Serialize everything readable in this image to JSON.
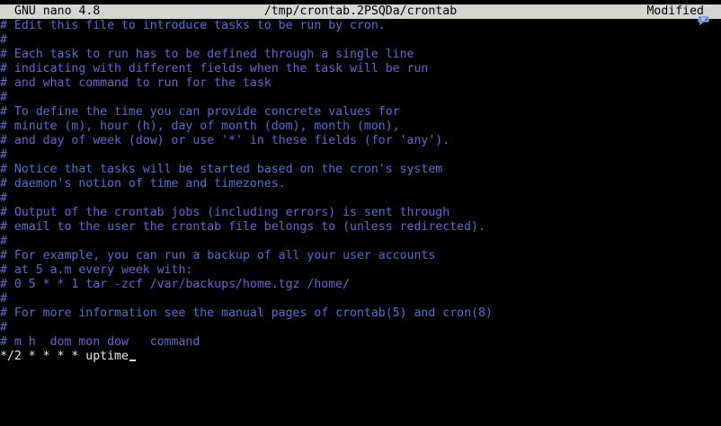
{
  "titlebar": {
    "app": "GNU nano 4.8",
    "file": "/tmp/crontab.2PSQDa/crontab",
    "status": "Modified"
  },
  "editor": {
    "lines": [
      "# Edit this file to introduce tasks to be run by cron.",
      "#",
      "# Each task to run has to be defined through a single line",
      "# indicating with different fields when the task will be run",
      "# and what command to run for the task",
      "#",
      "# To define the time you can provide concrete values for",
      "# minute (m), hour (h), day of month (dom), month (mon),",
      "# and day of week (dow) or use '*' in these fields (for 'any').",
      "#",
      "# Notice that tasks will be started based on the cron's system",
      "# daemon's notion of time and timezones.",
      "#",
      "# Output of the crontab jobs (including errors) is sent through",
      "# email to the user the crontab file belongs to (unless redirected).",
      "#",
      "# For example, you can run a backup of all your user accounts",
      "# at 5 a.m every week with:",
      "# 0 5 * * 1 tar -zcf /var/backups/home.tgz /home/",
      "#",
      "# For more information see the manual pages of crontab(5) and cron(8)",
      "#",
      "# m h  dom mon dow   command",
      "*/2 * * * * uptime"
    ]
  },
  "icons": {
    "notification": "speech-bubble-icon"
  },
  "colors": {
    "background": "#000000",
    "titlebar": "#d3d7cf",
    "comment": "#5c6ad6",
    "text": "#e8e8e8",
    "icon": "#3b7dd8"
  }
}
